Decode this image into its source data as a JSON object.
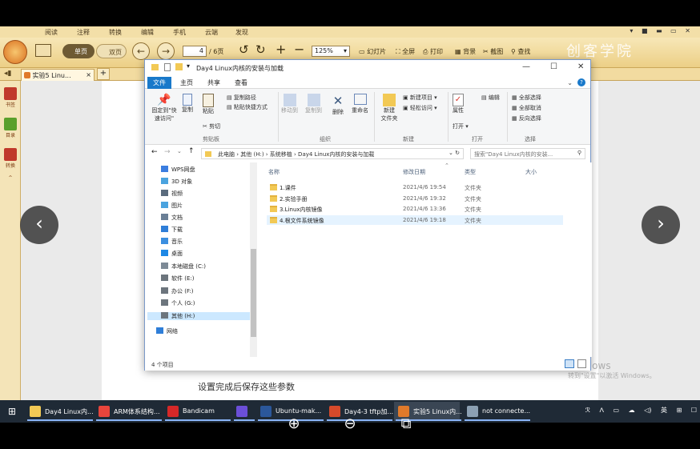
{
  "reader": {
    "menu": [
      "阅读",
      "注释",
      "转换",
      "编辑",
      "手机",
      "云端",
      "发现"
    ],
    "window_controls": "▾ ■ ▬ ▭ ✕",
    "view_single": "单页",
    "view_double": "双页",
    "page_current": "4",
    "page_total": "/ 6页",
    "zoom": "125%",
    "tools": [
      "幻灯片",
      "全屏",
      "打印",
      "背景",
      "截图",
      "查找"
    ],
    "brand_watermark": "创客学院",
    "tab_label": "实验5 Linu...",
    "tab_add": "+",
    "sidebar": [
      "书签",
      "目录",
      "转换"
    ],
    "page_caption": "设置完成后保存这些参数",
    "win_watermark_line1": "Windows",
    "win_watermark_line2": "转到\"设置\"以激活 Windows。"
  },
  "explorer": {
    "title": "Day4 Linux内核的安装与加载",
    "tabs": [
      "文件",
      "主页",
      "共享",
      "查看"
    ],
    "ribbon": {
      "clipboard": {
        "pin": "固定到\"快速访问\"",
        "copy": "复制",
        "paste": "粘贴",
        "copy_path": "复制路径",
        "paste_shortcut": "粘贴快捷方式",
        "cut": "剪切",
        "group": "剪贴板"
      },
      "organize": {
        "move_to": "移动到",
        "copy_to": "复制到",
        "delete": "删除",
        "rename": "重命名",
        "group": "组织"
      },
      "new": {
        "new_folder": "新建\n文件夹",
        "new_item": "新建项目 ▾",
        "easy_access": "轻松访问 ▾",
        "group": "新建"
      },
      "open": {
        "properties": "属性",
        "open": "打开 ▾",
        "edit": "编辑",
        "group": "打开"
      },
      "select": {
        "select_all": "全部选择",
        "select_none": "全部取消",
        "invert": "反向选择",
        "group": "选择"
      }
    },
    "address": [
      "此电脑",
      "系统移植",
      "系统移植",
      "Day4 Linux内核的安装与加载"
    ],
    "address_text": "此电脑  ›  其他 (H:)  ›  系统移植  ›  Day4 Linux内核的安装与加载",
    "search_placeholder": "搜索\"Day4 Linux内核的安装...",
    "nav": [
      {
        "label": "WPS网盘",
        "color": "#3b7de0"
      },
      {
        "label": "3D 对象",
        "color": "#4aa3df"
      },
      {
        "label": "视频",
        "color": "#5a6b7d"
      },
      {
        "label": "图片",
        "color": "#4aa3df"
      },
      {
        "label": "文档",
        "color": "#6a7f96"
      },
      {
        "label": "下载",
        "color": "#2f7ed8"
      },
      {
        "label": "音乐",
        "color": "#3b8fe0"
      },
      {
        "label": "桌面",
        "color": "#1e88e5"
      },
      {
        "label": "本地磁盘 (C:)",
        "color": "#7d8a96"
      },
      {
        "label": "软件 (E:)",
        "color": "#6c757d"
      },
      {
        "label": "办公 (F:)",
        "color": "#6c757d"
      },
      {
        "label": "个人 (G:)",
        "color": "#6c757d"
      },
      {
        "label": "其他 (H:)",
        "color": "#6c757d"
      },
      {
        "label": "网络",
        "color": "#2f7ed8"
      }
    ],
    "columns": [
      "名称",
      "修改日期",
      "类型",
      "大小"
    ],
    "files": [
      {
        "name": "1.课件",
        "date": "2021/4/6 19:54",
        "type": "文件夹"
      },
      {
        "name": "2.实验手册",
        "date": "2021/4/6 19:32",
        "type": "文件夹"
      },
      {
        "name": "3.Linux内核镜像",
        "date": "2021/4/6 13:36",
        "type": "文件夹"
      },
      {
        "name": "4.根文件系统镜像",
        "date": "2021/4/6 19:18",
        "type": "文件夹"
      }
    ],
    "status": "4 个项目"
  },
  "taskbar": {
    "items": [
      {
        "label": "Day4 Linux内...",
        "color": "#f2c955"
      },
      {
        "label": "ARM体系结构...",
        "color": "#e8453c"
      },
      {
        "label": "Bandicam",
        "color": "#d62828"
      },
      {
        "label": "",
        "color": "#6b4fd8"
      },
      {
        "label": "Ubuntu-mak...",
        "color": "#2b579a"
      },
      {
        "label": "Day4-3 tftp加...",
        "color": "#d64a2b"
      },
      {
        "label": "实验5 Linux内...",
        "color": "#e07a2b"
      },
      {
        "label": "not connecte...",
        "color": "#8ca0b3"
      }
    ],
    "tray": [
      "ℛ",
      "ᐱ",
      "▭",
      "☁",
      "◁)",
      "英",
      "⊞",
      "☐"
    ]
  },
  "colors": {
    "accent": "#1979ca",
    "reader_toolbar": "#eccf86",
    "taskbar": "#1f2a36"
  }
}
